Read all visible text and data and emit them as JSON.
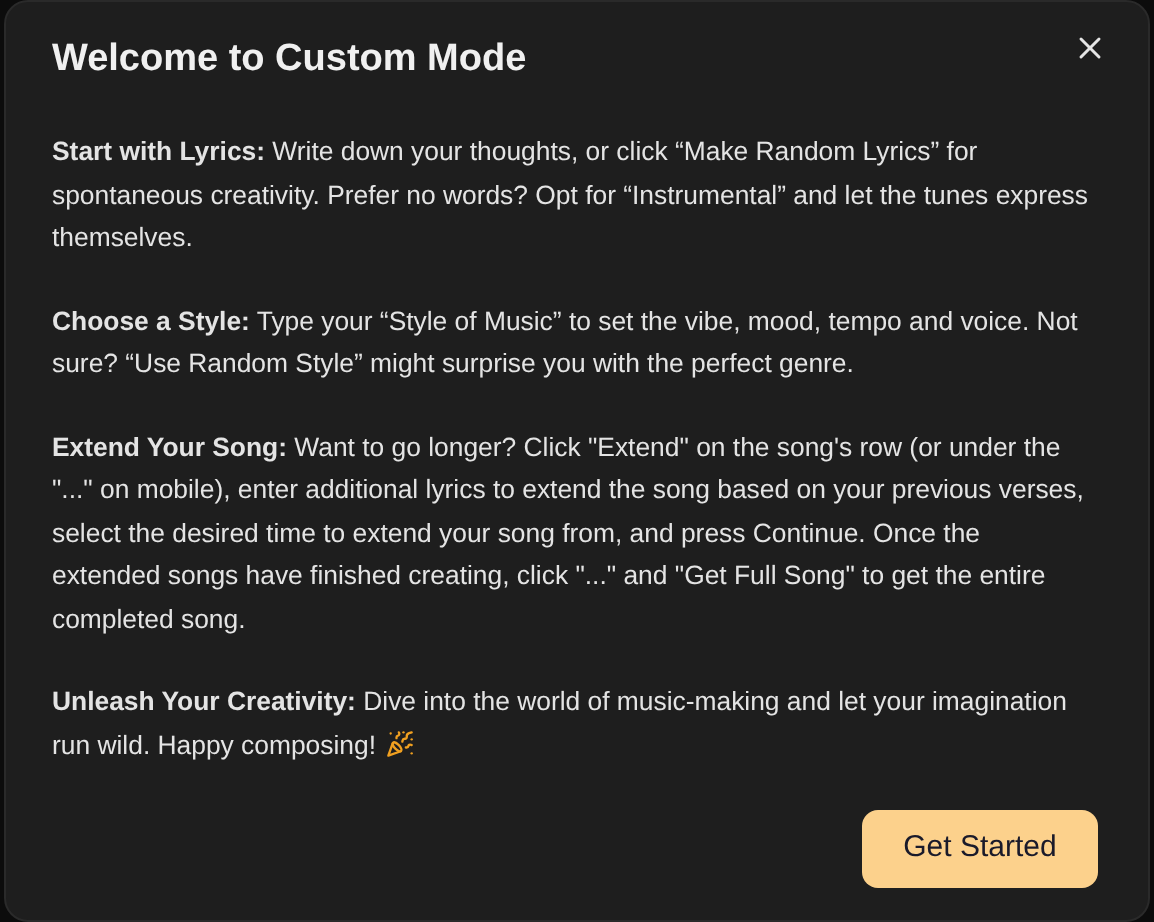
{
  "dialog": {
    "title": "Welcome to Custom Mode",
    "paragraphs": [
      {
        "text": "**Start with Lyrics:** Write down your thoughts, or click “Make Random Lyrics” for spontaneous creativity. Prefer no words? Opt for “Instrumental” and let the tunes express themselves.",
        "trailing_icon": false
      },
      {
        "text": "**Choose a Style:** Type your “Style of Music” to set the vibe, mood, tempo and voice. Not sure? “Use Random Style” might surprise you with the perfect genre.",
        "trailing_icon": false
      },
      {
        "text": "**Extend Your Song:** Want to go longer? Click \"Extend\" on the song's row (or under the \"...\" on mobile), enter additional lyrics to extend the song based on your previous verses, select the desired time to extend your song from, and press Continue. Once the extended songs have finished creating, click \"...\" and \"Get Full Song\" to get the entire completed song.",
        "trailing_icon": false
      },
      {
        "text": "**Unleash Your Creativity:** Dive into the world of music-making and let your imagination run wild. Happy composing!",
        "trailing_icon": true
      }
    ],
    "button": "Get Started"
  }
}
